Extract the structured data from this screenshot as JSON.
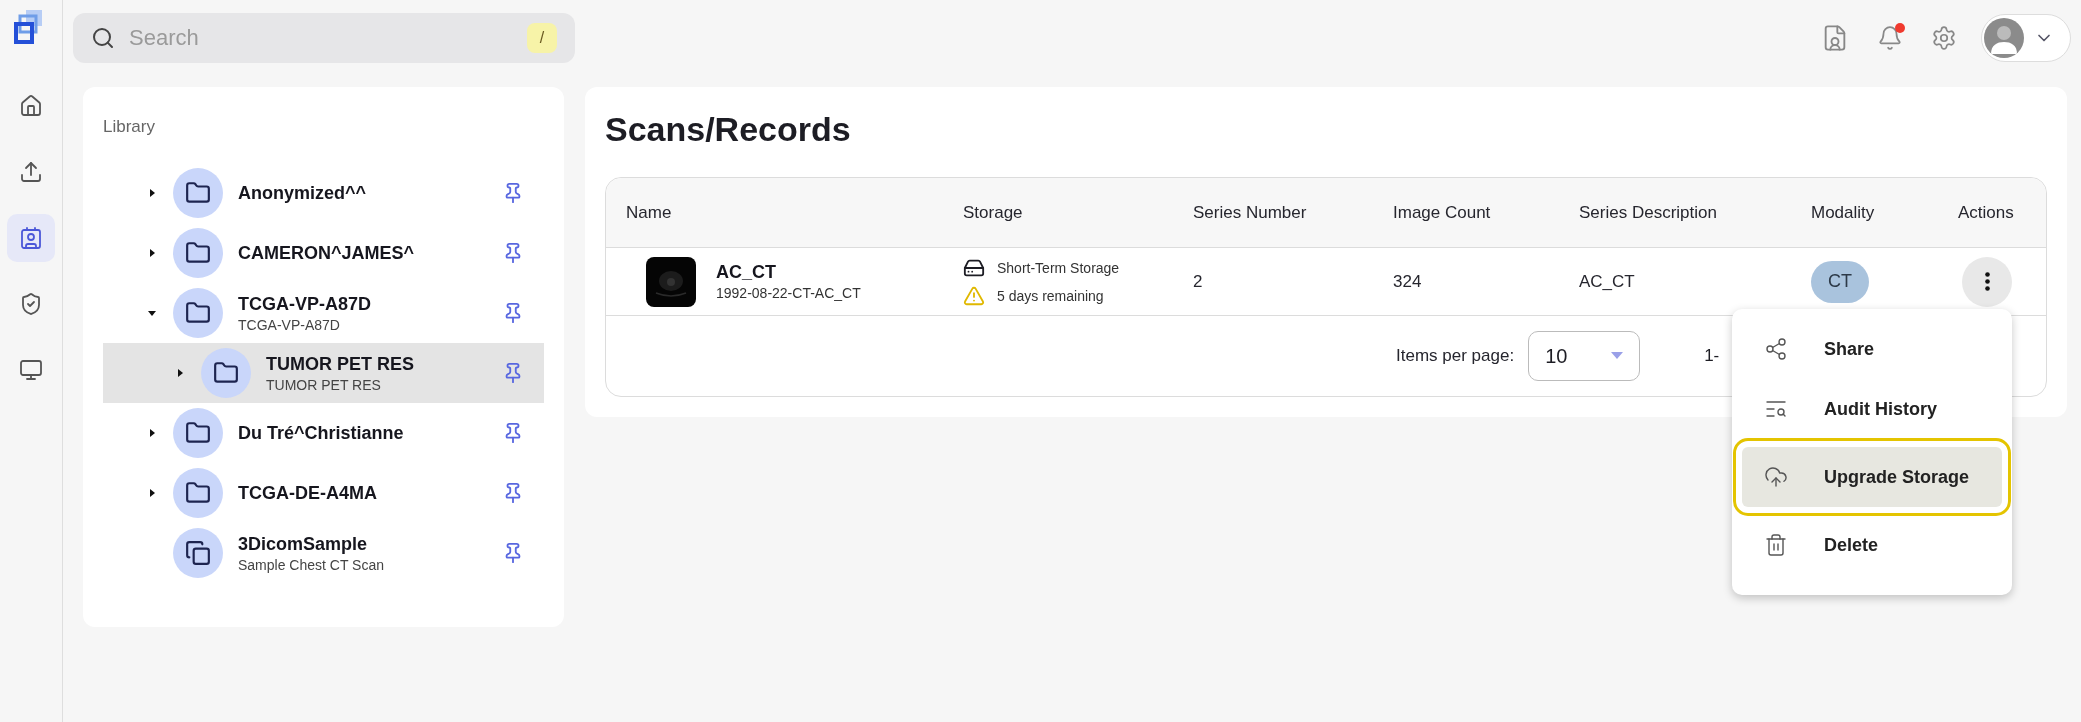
{
  "nav": {
    "items": [
      {
        "selected": false
      },
      {
        "selected": false
      },
      {
        "selected": true
      },
      {
        "selected": false
      },
      {
        "selected": false
      }
    ]
  },
  "search": {
    "placeholder": "Search",
    "shortcut": "/"
  },
  "notifications": {
    "unread": true
  },
  "library": {
    "title": "Library",
    "items": [
      {
        "kind": "folder",
        "name": "Anonymized^^",
        "expanded": false,
        "selected": false
      },
      {
        "kind": "folder",
        "name": "CAMERON^JAMES^",
        "expanded": false,
        "selected": false
      },
      {
        "kind": "folder",
        "name": "TCGA-VP-A87D",
        "subtitle": "TCGA-VP-A87D",
        "expanded": true,
        "selected": false,
        "children": [
          {
            "kind": "folder",
            "name": "TUMOR PET RES",
            "subtitle": "TUMOR PET RES",
            "expanded": false,
            "selected": true
          }
        ]
      },
      {
        "kind": "folder",
        "name": "Du Tré^Christianne",
        "expanded": false,
        "selected": false
      },
      {
        "kind": "folder",
        "name": "TCGA-DE-A4MA",
        "expanded": false,
        "selected": false
      },
      {
        "kind": "sample",
        "name": "3DicomSample",
        "subtitle": "Sample Chest CT Scan",
        "selected": false
      }
    ]
  },
  "main": {
    "title": "Scans/Records",
    "table": {
      "columns": [
        "Name",
        "Storage",
        "Series Number",
        "Image Count",
        "Series Description",
        "Modality",
        "Actions"
      ],
      "rows": [
        {
          "name": "AC_CT",
          "subtitle": "1992-08-22-CT-AC_CT",
          "storage": "Short-Term Storage",
          "warning": "5 days remaining",
          "series_number": "2",
          "image_count": "324",
          "series_description": "AC_CT",
          "modality": "CT"
        }
      ],
      "footer": {
        "items_per_page_label": "Items per page:",
        "items_per_page": "10",
        "range": "1-"
      }
    },
    "menu": {
      "items": [
        {
          "label": "Share",
          "selected": false
        },
        {
          "label": "Audit History",
          "selected": false
        },
        {
          "label": "Upgrade Storage",
          "selected": true
        },
        {
          "label": "Delete",
          "selected": false
        }
      ]
    }
  }
}
